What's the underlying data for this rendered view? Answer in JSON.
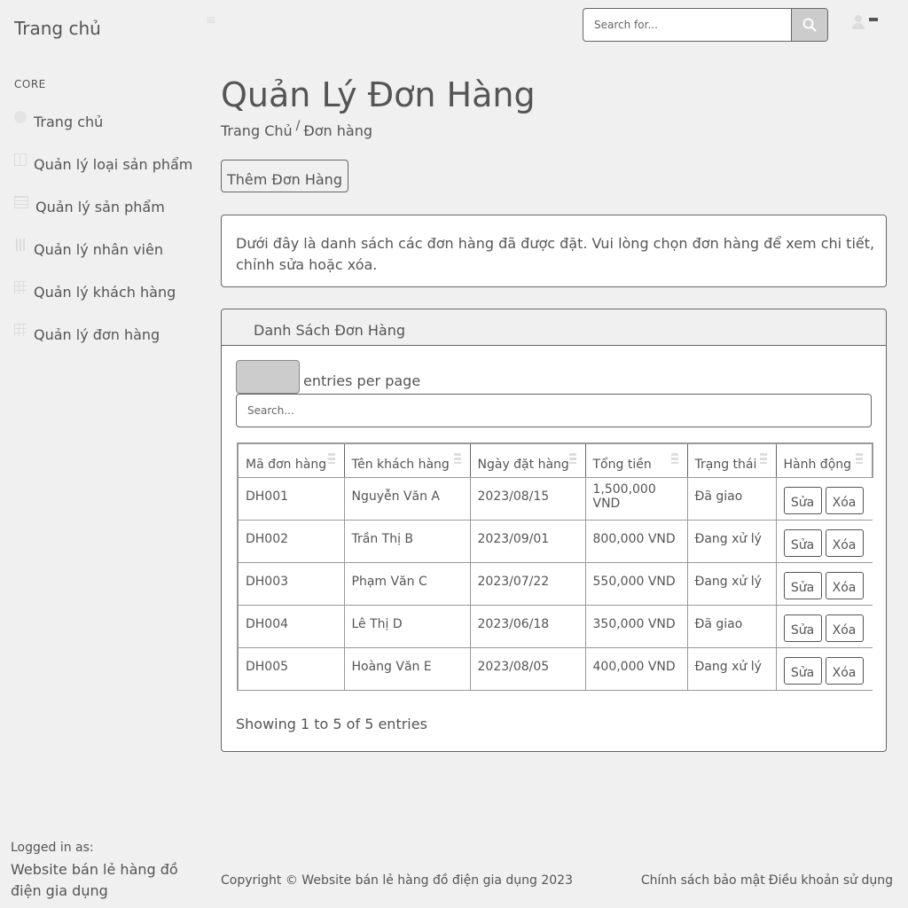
{
  "header": {
    "brand": "Trang chủ",
    "search_placeholder": "Search for..."
  },
  "sidebar": {
    "heading": "CORE",
    "items": [
      {
        "label": "Trang chủ",
        "icon": "dashboard-icon"
      },
      {
        "label": "Quản lý loại sản phẩm",
        "icon": "columns-icon"
      },
      {
        "label": "Quản lý sản phẩm",
        "icon": "table-icon"
      },
      {
        "label": "Quản lý nhân viên",
        "icon": "chart-icon"
      },
      {
        "label": "Quản lý khách hàng",
        "icon": "grid-icon"
      },
      {
        "label": "Quản lý đơn hàng",
        "icon": "grid-icon"
      }
    ],
    "logged_in_label": "Logged in as:",
    "logged_in_name": "Website bán lẻ hàng đồ điện gia dụng"
  },
  "main": {
    "title": "Quản Lý Đơn Hàng",
    "breadcrumb": [
      "Trang Chủ",
      "/",
      "Đơn hàng"
    ],
    "add_button": "Thêm Đơn Hàng",
    "description": "Dưới đây là danh sách các đơn hàng đã được đặt. Vui lòng chọn đơn hàng để xem chi tiết, chỉnh sửa hoặc xóa.",
    "card_title": "Danh Sách Đơn Hàng",
    "entries_label": "entries per page",
    "table_search_placeholder": "Search...",
    "columns": [
      "Mã đơn hàng",
      "Tên khách hàng",
      "Ngày đặt hàng",
      "Tổng tiền",
      "Trạng thái",
      "Hành động"
    ],
    "rows": [
      {
        "id": "DH001",
        "customer": "Nguyễn Văn A",
        "date": "2023/08/15",
        "total": "1,500,000 VND",
        "status": "Đã giao"
      },
      {
        "id": "DH002",
        "customer": "Trần Thị B",
        "date": "2023/09/01",
        "total": "800,000 VND",
        "status": "Đang xử lý"
      },
      {
        "id": "DH003",
        "customer": "Phạm Văn C",
        "date": "2023/07/22",
        "total": "550,000 VND",
        "status": "Đang xử lý"
      },
      {
        "id": "DH004",
        "customer": "Lê Thị D",
        "date": "2023/06/18",
        "total": "350,000 VND",
        "status": "Đã giao"
      },
      {
        "id": "DH005",
        "customer": "Hoàng Văn E",
        "date": "2023/08/05",
        "total": "400,000 VND",
        "status": "Đang xử lý"
      }
    ],
    "edit_label": "Sửa",
    "delete_label": "Xóa",
    "showing": "Showing 1 to 5 of 5 entries"
  },
  "footer": {
    "copyright": "Copyright © Website bán lẻ hàng đồ điện gia dụng 2023",
    "links": [
      "Chính sách bảo mật",
      "Điều khoản sử dụng"
    ]
  }
}
